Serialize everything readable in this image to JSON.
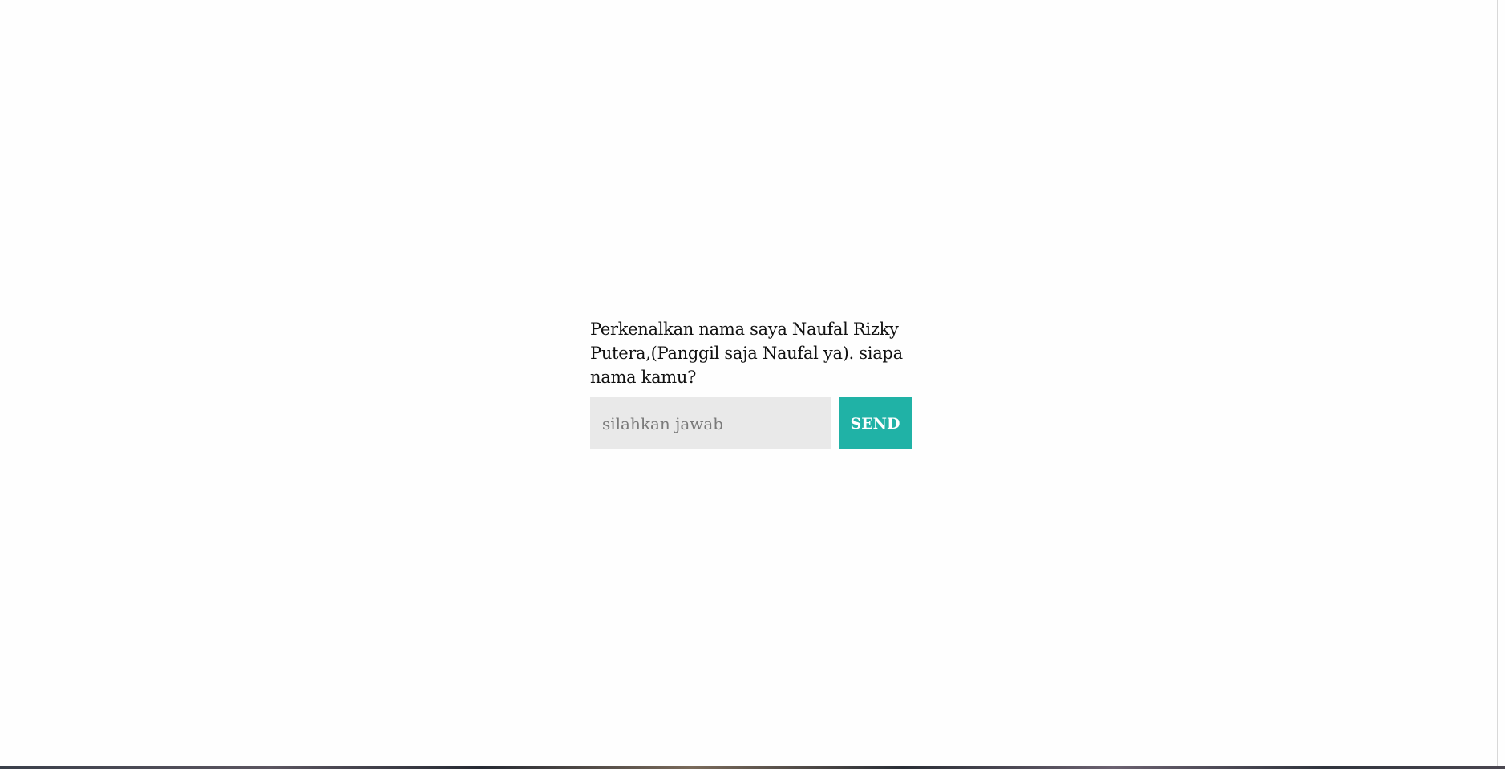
{
  "chat": {
    "question": "Perkenalkan nama saya Naufal Rizky Putera,(Panggil saja Naufal ya). siapa nama kamu?",
    "input": {
      "placeholder": "silahkan jawab",
      "value": ""
    },
    "send_label": "SEND"
  },
  "colors": {
    "accent": "#20b2a6",
    "input_background": "#e9e9e9",
    "page_background": "#fefefe"
  }
}
